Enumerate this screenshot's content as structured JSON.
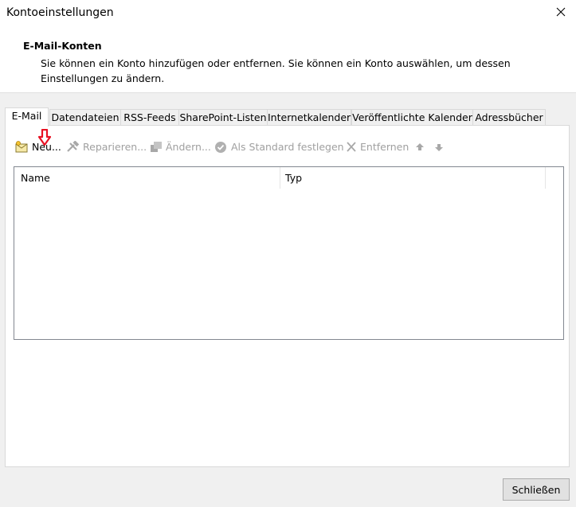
{
  "window": {
    "title": "Kontoeinstellungen",
    "close_icon": "close-icon"
  },
  "section": {
    "heading": "E-Mail-Konten",
    "description": "Sie können ein Konto hinzufügen oder entfernen. Sie können ein Konto auswählen, um dessen Einstellungen zu ändern."
  },
  "tabs": [
    {
      "label": "E-Mail",
      "active": true
    },
    {
      "label": "Datendateien"
    },
    {
      "label": "RSS-Feeds"
    },
    {
      "label": "SharePoint-Listen"
    },
    {
      "label": "Internetkalender"
    },
    {
      "label": "Veröffentlichte Kalender"
    },
    {
      "label": "Adressbücher"
    }
  ],
  "toolbar": {
    "new_label": "Neu...",
    "repair_label": "Reparieren...",
    "change_label": "Ändern...",
    "default_label": "Als Standard festlegen",
    "remove_label": "Entfernen",
    "up_icon": "arrow-up-icon",
    "down_icon": "arrow-down-icon"
  },
  "accounts_list": {
    "columns": [
      "Name",
      "Typ"
    ],
    "rows": []
  },
  "footer": {
    "close_label": "Schließen"
  },
  "colors": {
    "annotation_arrow": "#e81123",
    "disabled_text": "#a0a0a0",
    "window_bg": "#f0f0f0"
  }
}
